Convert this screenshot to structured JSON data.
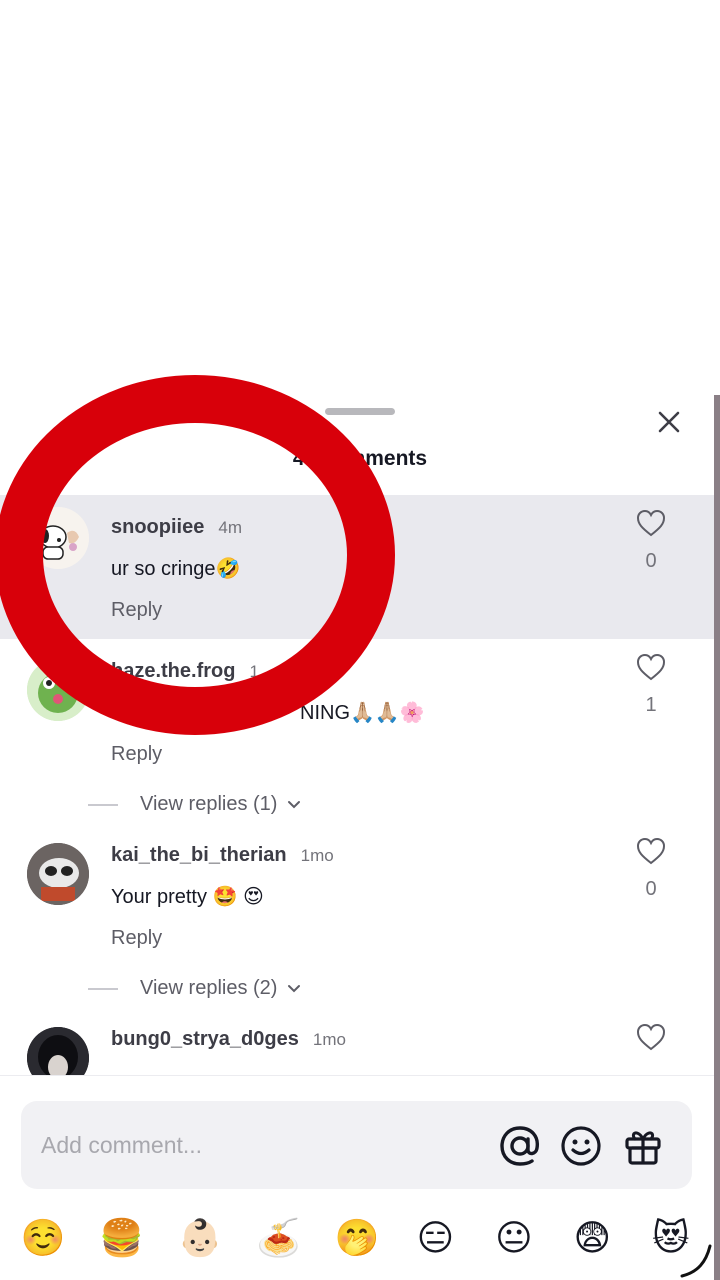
{
  "header": {
    "title": "40 comments",
    "close_icon": "close-icon"
  },
  "comments": [
    {
      "user": "snoopiiee",
      "time": "4m",
      "text": "ur so cringe🤣",
      "reply": "Reply",
      "likes": "0",
      "highlighted": true
    },
    {
      "user": "haze.the.frog",
      "time": "1",
      "text": "NING🙏🏼🙏🏼🌸",
      "reply": "Reply",
      "likes": "1",
      "view_replies": "View replies (1)"
    },
    {
      "user": "kai_the_bi_therian",
      "time": "1mo",
      "text": "Your pretty 🤩 😍",
      "reply": "Reply",
      "likes": "0",
      "view_replies": "View replies (2)"
    },
    {
      "user": "bung0_strya_d0ges",
      "time": "1mo"
    }
  ],
  "input": {
    "placeholder": "Add comment...",
    "icons": [
      "at-icon",
      "emoji-icon",
      "gift-icon"
    ]
  },
  "emoji_bar": [
    "☺️",
    "🍔",
    "👶🏻",
    "🍝",
    "🤭",
    "😑",
    "😐",
    "😨",
    "😻"
  ],
  "colors": {
    "highlight_bg": "#e9e9ee",
    "overlay_ring": "#d8000a"
  }
}
